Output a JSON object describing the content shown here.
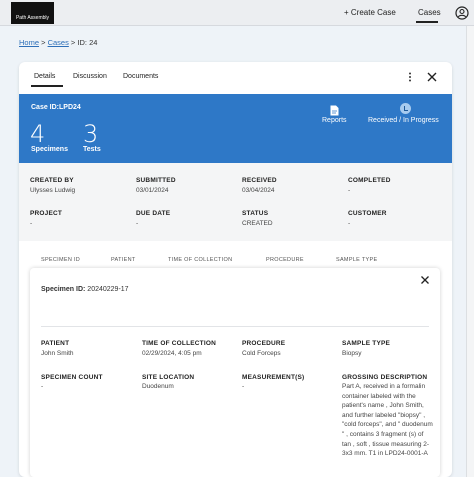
{
  "app": {
    "logo_text": "Path Assembly",
    "nav": {
      "create_case": "+ Create Case",
      "cases": "Cases"
    }
  },
  "breadcrumb": {
    "home": "Home",
    "sep1": " > ",
    "cases": "Cases",
    "sep2": " > ",
    "current": "ID: 24"
  },
  "tabs": [
    "Details",
    "Discussion",
    "Documents"
  ],
  "case": {
    "id_label": "Case ID:LPD24",
    "specimens_count": "4",
    "specimens_label": "Specimens",
    "tests_count": "3",
    "tests_label": "Tests",
    "reports_label": "Reports",
    "status_label": "Received / In Progress"
  },
  "info": {
    "created_by_label": "CREATED BY",
    "created_by": "Ulysses Ludwig",
    "submitted_label": "SUBMITTED",
    "submitted": "03/01/2024",
    "received_label": "RECEIVED",
    "received": "03/04/2024",
    "completed_label": "COMPLETED",
    "completed": "-",
    "project_label": "PROJECT",
    "project": "-",
    "due_date_label": "DUE DATE",
    "due_date": "-",
    "status_label": "STATUS",
    "status": "CREATED",
    "customer_label": "CUSTOMER",
    "customer": "-"
  },
  "specimen_table": {
    "columns": [
      "SPECIMEN ID",
      "PATIENT",
      "TIME OF COLLECTION",
      "PROCEDURE",
      "SAMPLE TYPE"
    ]
  },
  "specimen": {
    "id_label": "Specimen ID:",
    "id": " 20240229-17",
    "patient_label": "PATIENT",
    "patient": "John Smith",
    "time_label": "TIME OF COLLECTION",
    "time": "02/29/2024, 4:05 pm",
    "procedure_label": "PROCEDURE",
    "procedure": "Cold Forceps",
    "sample_type_label": "SAMPLE TYPE",
    "sample_type": "Biopsy",
    "count_label": "SPECIMEN COUNT",
    "count": "-",
    "site_label": "SITE LOCATION",
    "site": "Duodenum",
    "measurements_label": "MEASUREMENT(S)",
    "measurements": "-",
    "gross_label": "GROSSING DESCRIPTION",
    "gross": "Part A, received in a formalin container labeled with the patient's name , John Smith, and further labeled \"biopsy\" , \"cold forceps\", and \" duodenum \" , contains 3 fragment (s) of tan , soft , tissue measuring 2- 3x3 mm. T1 in LPD24-0001-A"
  }
}
